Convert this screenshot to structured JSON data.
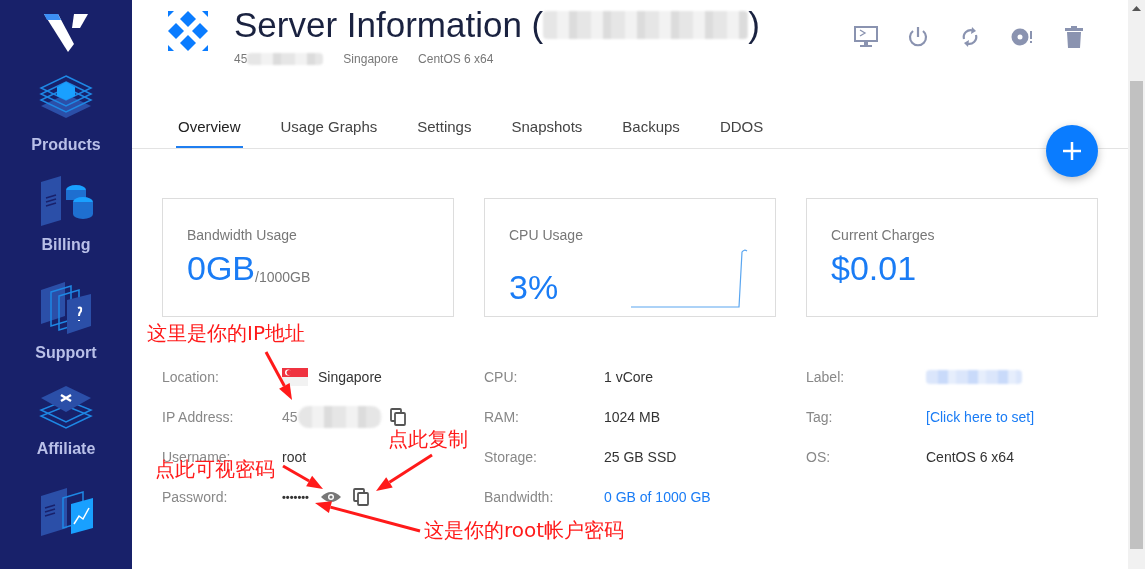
{
  "sidebar": {
    "items": [
      {
        "label": "Products"
      },
      {
        "label": "Billing"
      },
      {
        "label": "Support"
      },
      {
        "label": "Affiliate"
      }
    ]
  },
  "header": {
    "title": "Server Information (",
    "title_end": ")",
    "subtitle": {
      "ip": "45",
      "location": "Singapore",
      "os": "CentOS 6 x64"
    }
  },
  "tabs": [
    {
      "label": "Overview",
      "selected": true
    },
    {
      "label": "Usage Graphs",
      "selected": false
    },
    {
      "label": "Settings",
      "selected": false
    },
    {
      "label": "Snapshots",
      "selected": false
    },
    {
      "label": "Backups",
      "selected": false
    },
    {
      "label": "DDOS",
      "selected": false
    }
  ],
  "cards": [
    {
      "title": "Bandwidth Usage",
      "value": "0GB",
      "suffix": "/1000GB"
    },
    {
      "title": "CPU Usage",
      "value": "3%",
      "sparkline": true
    },
    {
      "title": "Current Charges",
      "value": "$0.01"
    }
  ],
  "details": [
    [
      {
        "label": "Location:",
        "kind": "flag",
        "value": "Singapore"
      },
      {
        "label": "IP Address:",
        "kind": "ip",
        "value": "45"
      },
      {
        "label": "Username:",
        "kind": "text",
        "value": "root"
      },
      {
        "label": "Password:",
        "kind": "password",
        "value": "•••••••"
      }
    ],
    [
      {
        "label": "CPU:",
        "kind": "text",
        "value": "1 vCore"
      },
      {
        "label": "RAM:",
        "kind": "text",
        "value": "1024 MB"
      },
      {
        "label": "Storage:",
        "kind": "text",
        "value": "25 GB SSD"
      },
      {
        "label": "Bandwidth:",
        "kind": "link",
        "value": "0 GB of 1000 GB"
      }
    ],
    [
      {
        "label": "Label:",
        "kind": "redacted"
      },
      {
        "label": "Tag:",
        "kind": "link",
        "value": "[Click here to set]"
      },
      {
        "label": "OS:",
        "kind": "text",
        "value": "CentOS 6 x64"
      }
    ]
  ],
  "annotations": [
    {
      "text": "这里是你的IP地址"
    },
    {
      "text": "点此复制"
    },
    {
      "text": "点此可视密码"
    },
    {
      "text": "这是你的root帐户密码"
    }
  ]
}
